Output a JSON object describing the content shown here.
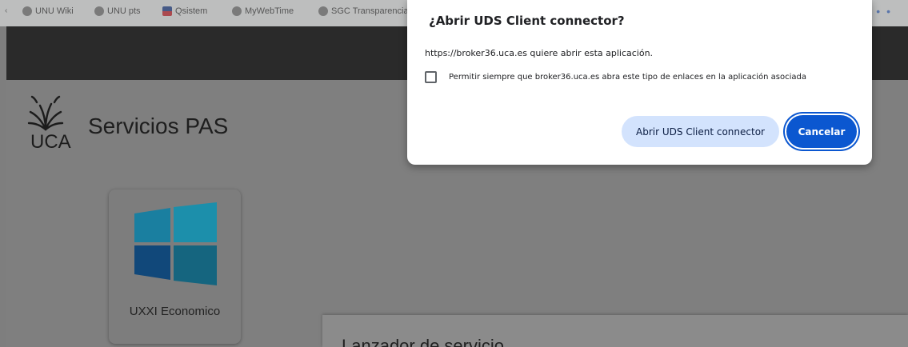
{
  "bookmarks": {
    "items": [
      {
        "label": "UNU Wiki",
        "icon": "globe-icon"
      },
      {
        "label": "UNU pts",
        "icon": "globe-icon"
      },
      {
        "label": "Qsistem",
        "icon": "flag-icon"
      },
      {
        "label": "MyWebTime",
        "icon": "clock-icon"
      },
      {
        "label": "SGC Transparencia",
        "icon": "globe-icon"
      }
    ]
  },
  "site": {
    "logo_text": "UCA",
    "title": "Servicios PAS"
  },
  "tile": {
    "label": "UXXI Economico",
    "icon": "windows-icon"
  },
  "launcher": {
    "title": "Lanzador de servicio"
  },
  "dialog": {
    "title": "¿Abrir UDS Client connector?",
    "message": "https://broker36.uca.es quiere abrir esta aplicación.",
    "checkbox_label": "Permitir siempre que broker36.uca.es abra este tipo de enlaces en la aplicación asociada",
    "checkbox_checked": false,
    "open_button": "Abrir UDS Client connector",
    "cancel_button": "Cancelar"
  },
  "colors": {
    "primary": "#0b57d0",
    "tonal": "#d3e3fd",
    "overlay": "#7f7f7f"
  }
}
